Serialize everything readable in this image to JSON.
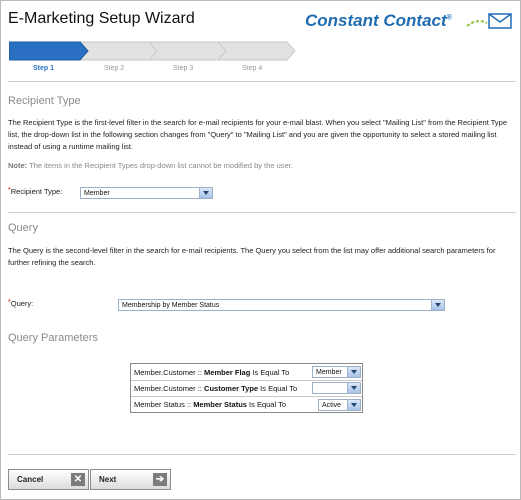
{
  "header": {
    "title": "E-Marketing Setup Wizard",
    "logo_text": "Constant Contact",
    "logo_mark": "®"
  },
  "steps": [
    {
      "label": "Step 1"
    },
    {
      "label": "Step 2"
    },
    {
      "label": "Step 3"
    },
    {
      "label": "Step 4"
    }
  ],
  "recipient": {
    "heading": "Recipient Type",
    "description": "The Recipient Type is the first-level filter in the search for e-mail recipients for your e-mail blast. When you select \"Mailing List\" from the Recipient Type list, the drop-down list in the following section changes from \"Query\" to \"Mailing List\" and you are given the opportunity to select a stored mailing list instead of using a runtime mailing list.",
    "note_label": "Note:",
    "note_text": " The items in the Recipient Types drop-down list cannot be modified by the user.",
    "field_label": "Recipient Type:",
    "required_mark": "*",
    "value": "Member"
  },
  "query": {
    "heading": "Query",
    "description": "The Query is the second-level filter in the search for e-mail recipients. The Query you select from the list may offer additional search parameters for further refining the search.",
    "field_label": "Query:",
    "required_mark": "*",
    "value": "Membership by Member Status"
  },
  "params": {
    "heading": "Query Parameters",
    "rows": [
      {
        "prefix": "Member.Customer :: ",
        "field": "Member Flag",
        "op": " Is Equal To",
        "value": "Member"
      },
      {
        "prefix": "Member.Customer :: ",
        "field": "Customer Type",
        "op": " Is Equal To",
        "value": ""
      },
      {
        "prefix": "Member Status :: ",
        "field": "Member Status",
        "op": " Is Equal To",
        "value": "Active"
      }
    ]
  },
  "buttons": {
    "cancel": "Cancel",
    "cancel_icon": "✕",
    "next": "Next",
    "next_icon": "➔"
  }
}
